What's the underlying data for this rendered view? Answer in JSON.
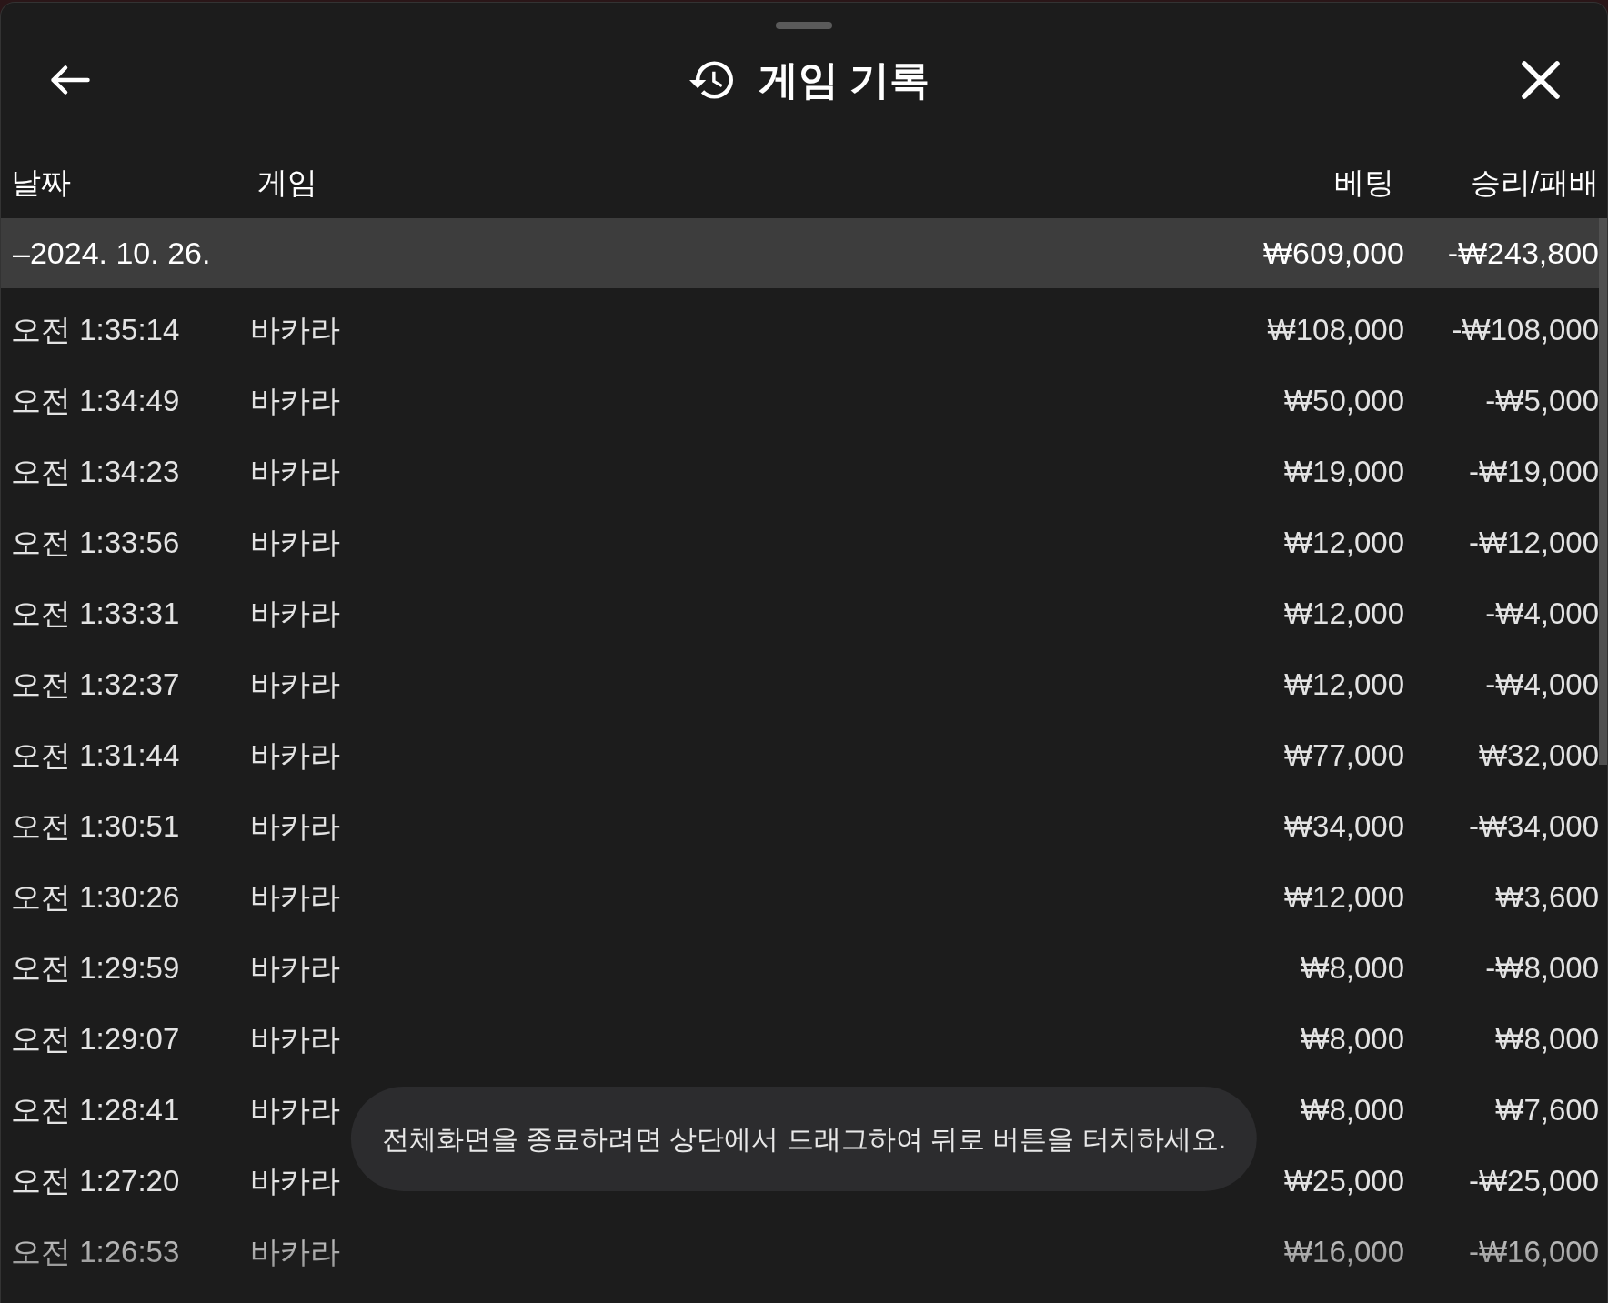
{
  "header": {
    "title": "게임 기록"
  },
  "table": {
    "columns": [
      "날짜",
      "게임",
      "베팅",
      "승리/패배"
    ],
    "groups": [
      {
        "date": "–2024. 10. 26.",
        "bet_total": "₩609,000",
        "result_total": "-₩243,800",
        "rows": [
          {
            "time": "오전 1:35:14",
            "game": "바카라",
            "bet": "₩108,000",
            "result": "-₩108,000"
          },
          {
            "time": "오전 1:34:49",
            "game": "바카라",
            "bet": "₩50,000",
            "result": "-₩5,000"
          },
          {
            "time": "오전 1:34:23",
            "game": "바카라",
            "bet": "₩19,000",
            "result": "-₩19,000"
          },
          {
            "time": "오전 1:33:56",
            "game": "바카라",
            "bet": "₩12,000",
            "result": "-₩12,000"
          },
          {
            "time": "오전 1:33:31",
            "game": "바카라",
            "bet": "₩12,000",
            "result": "-₩4,000"
          },
          {
            "time": "오전 1:32:37",
            "game": "바카라",
            "bet": "₩12,000",
            "result": "-₩4,000"
          },
          {
            "time": "오전 1:31:44",
            "game": "바카라",
            "bet": "₩77,000",
            "result": "₩32,000"
          },
          {
            "time": "오전 1:30:51",
            "game": "바카라",
            "bet": "₩34,000",
            "result": "-₩34,000"
          },
          {
            "time": "오전 1:30:26",
            "game": "바카라",
            "bet": "₩12,000",
            "result": "₩3,600"
          },
          {
            "time": "오전 1:29:59",
            "game": "바카라",
            "bet": "₩8,000",
            "result": "-₩8,000"
          },
          {
            "time": "오전 1:29:07",
            "game": "바카라",
            "bet": "₩8,000",
            "result": "₩8,000"
          },
          {
            "time": "오전 1:28:41",
            "game": "바카라",
            "bet": "₩8,000",
            "result": "₩7,600"
          },
          {
            "time": "오전 1:27:20",
            "game": "바카라",
            "bet": "₩25,000",
            "result": "-₩25,000"
          },
          {
            "time": "오전 1:26:53",
            "game": "바카라",
            "bet": "₩16,000",
            "result": "-₩16,000"
          }
        ]
      }
    ]
  },
  "toast": {
    "message": "전체화면을 종료하려면 상단에서 드래그하여 뒤로 버튼을 터치하세요."
  }
}
